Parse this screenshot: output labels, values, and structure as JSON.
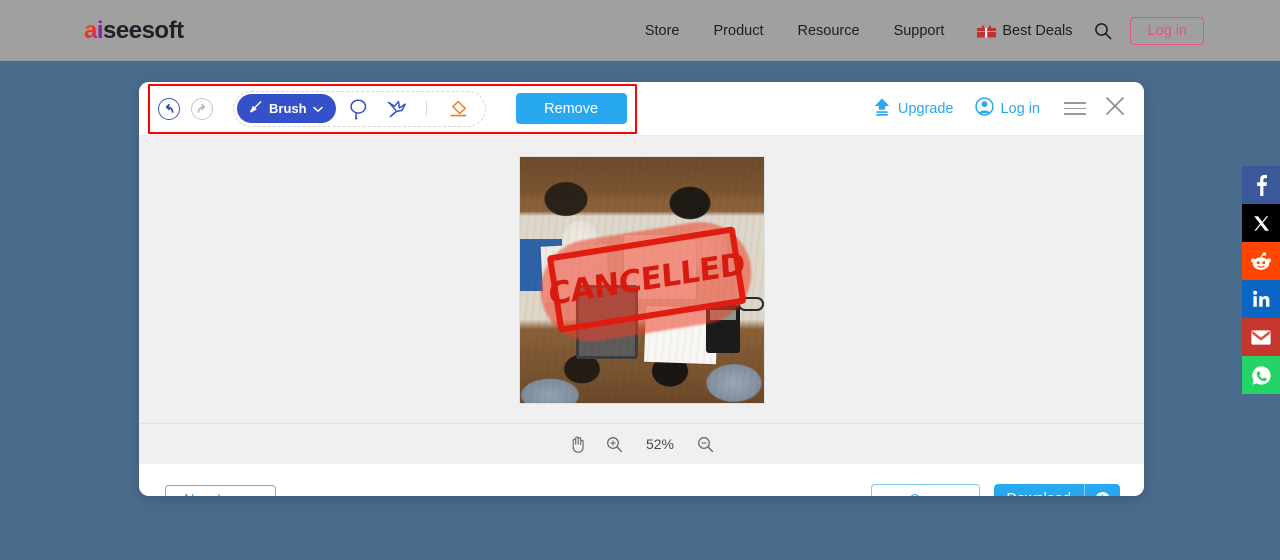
{
  "site_header": {
    "brand": {
      "part_a": "a",
      "part_i": "i",
      "part_rest": "seesoft"
    },
    "nav": [
      {
        "label": "Store",
        "name": "nav-store"
      },
      {
        "label": "Product",
        "name": "nav-product"
      },
      {
        "label": "Resource",
        "name": "nav-resource"
      },
      {
        "label": "Support",
        "name": "nav-support"
      }
    ],
    "best_deals_label": "Best Deals",
    "search_icon": "search-icon",
    "login_label": "Log in",
    "bg_color": "#a0a0a0",
    "login_color": "#e0557f"
  },
  "editor": {
    "toolbar": {
      "undo_icon": "undo-arrow-icon",
      "redo_icon": "redo-arrow-icon",
      "brush_label": "Brush",
      "brush_icon": "paintbrush-icon",
      "brush_caret": "chevron-down-icon",
      "lasso_icon": "lasso-icon",
      "polygon_icon": "polygon-select-icon",
      "eraser_icon": "eraser-icon",
      "remove_label": "Remove",
      "remove_color": "#29a8f2",
      "brush_pill_color": "#3550c8",
      "highlight_box_color": "#ff0000"
    },
    "header_actions": {
      "upgrade_label": "Upgrade",
      "upgrade_icon": "upload-arrow-icon",
      "login_label": "Log in",
      "login_icon": "user-circle-icon",
      "menu_icon": "hamburger-menu-icon",
      "close_icon": "close-x-icon",
      "accent_color": "#29a8f2"
    },
    "canvas": {
      "stamp_text": "CANCELLED",
      "stamp_color": "#d8190e",
      "background": "#f0f0f0"
    },
    "zoom_bar": {
      "pan_icon": "hand-pan-icon",
      "zoom_in_icon": "zoom-in-icon",
      "zoom_out_icon": "zoom-out-icon",
      "level": "52%"
    },
    "footer": {
      "new_image_label": "New Image",
      "crop_label": "Crop",
      "download_label": "Download",
      "download_history_icon": "clock-icon",
      "download_color": "#29a8f2"
    }
  },
  "social_rail": [
    {
      "name": "facebook-share-button",
      "glyph": "f",
      "color": "#3b5998"
    },
    {
      "name": "x-twitter-share-button",
      "glyph": "✕",
      "color": "#000000"
    },
    {
      "name": "reddit-share-button",
      "glyph": "◉",
      "color": "#ff4500"
    },
    {
      "name": "linkedin-share-button",
      "glyph": "in",
      "color": "#0a66c2"
    },
    {
      "name": "gmail-share-button",
      "glyph": "M",
      "color": "#c5362c"
    },
    {
      "name": "whatsapp-share-button",
      "glyph": "✆",
      "color": "#25d366"
    }
  ],
  "page": {
    "background": "#4a6c8c"
  }
}
